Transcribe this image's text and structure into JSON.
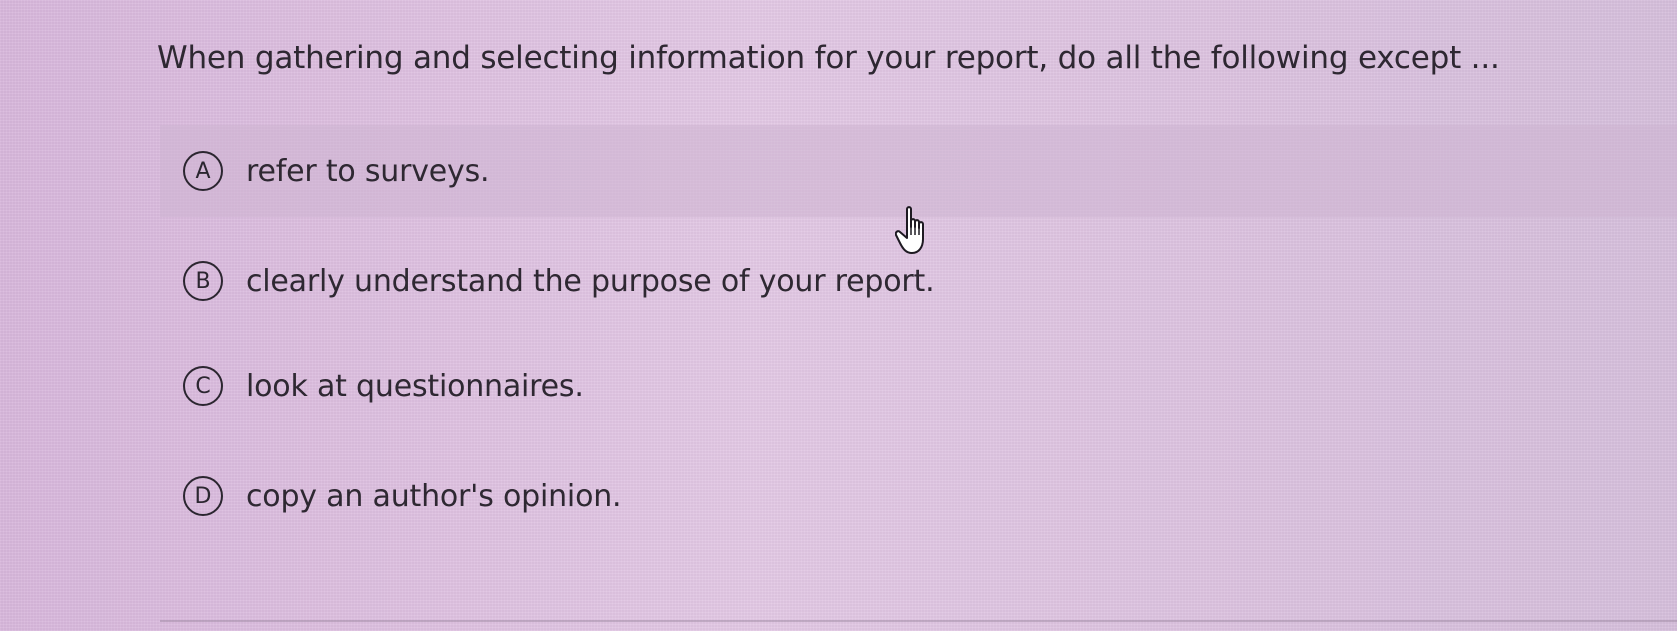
{
  "question": {
    "text": "When gathering and selecting information for your report, do all the following except ..."
  },
  "options": [
    {
      "letter": "A",
      "text": "refer to surveys."
    },
    {
      "letter": "B",
      "text": "clearly understand the purpose of your report."
    },
    {
      "letter": "C",
      "text": "look at questionnaires."
    },
    {
      "letter": "D",
      "text": "copy an author's opinion."
    }
  ],
  "cursor": {
    "icon": "hand-pointer-icon"
  },
  "colors": {
    "background": "#e0c6e2",
    "highlight_row": "#d6bcd9",
    "text": "#2e2832"
  }
}
